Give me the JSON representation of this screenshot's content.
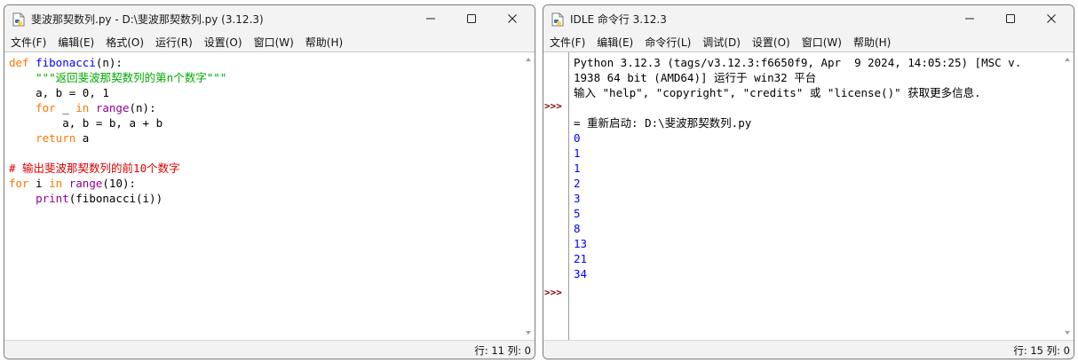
{
  "editor": {
    "title": "斐波那契数列.py - D:\\斐波那契数列.py (3.12.3)",
    "menu": [
      "文件(F)",
      "编辑(E)",
      "格式(O)",
      "运行(R)",
      "设置(O)",
      "窗口(W)",
      "帮助(H)"
    ],
    "code": {
      "l1_kw": "def",
      "l1_name": "fibonacci",
      "l1_rest": "(n):",
      "l2_doc": "\"\"\"返回斐波那契数列的第n个数字\"\"\"",
      "l3": "a, b = 0, 1",
      "l4_kw1": "for",
      "l4_mid1": " _ ",
      "l4_kw2": "in",
      "l4_bi": "range",
      "l4_rest": "(n):",
      "l5": "a, b = b, a + b",
      "l6_kw": "return",
      "l6_rest": " a",
      "l8_cmt": "# 输出斐波那契数列的前10个数字",
      "l9_kw1": "for",
      "l9_mid": " i ",
      "l9_kw2": "in",
      "l9_bi": "range",
      "l9_rest": "(10):",
      "l10_bi": "print",
      "l10_rest": "(fibonacci(i))"
    },
    "status": {
      "line": "行: 11",
      "col": "列: 0"
    }
  },
  "shell": {
    "title": "IDLE 命令行 3.12.3",
    "menu": [
      "文件(F)",
      "编辑(E)",
      "命令行(L)",
      "调试(D)",
      "设置(O)",
      "窗口(W)",
      "帮助(H)"
    ],
    "banner_1": "Python 3.12.3 (tags/v3.12.3:f6650f9, Apr  9 2024, 14:05:25) [MSC v.",
    "banner_2": "1938 64 bit (AMD64)] 运行于 win32 平台",
    "banner_3": "输入 \"help\", \"copyright\", \"credits\" 或 \"license()\" 获取更多信息.",
    "restart": "= 重新启动: D:\\斐波那契数列.py",
    "prompt": ">>>",
    "output": [
      "0",
      "1",
      "1",
      "2",
      "3",
      "5",
      "8",
      "13",
      "21",
      "34"
    ],
    "status": {
      "line": "行: 15",
      "col": "列: 0"
    }
  },
  "colors": {
    "keyword": "#ff7700",
    "definition": "#0000ff",
    "builtin": "#900090",
    "string": "#00aa00",
    "comment": "#dd0000",
    "stdout": "#0000ff",
    "prompt": "#8b0000"
  },
  "icons": [
    "python-idle-icon",
    "minimize-icon",
    "maximize-icon",
    "close-icon",
    "scroll-up-icon",
    "scroll-down-icon"
  ]
}
